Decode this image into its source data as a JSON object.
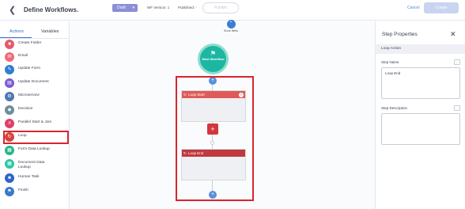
{
  "header": {
    "title": "Define Workflows.",
    "status": "Draft",
    "wf_version_label": "WF Version: 1",
    "published_label": "Published: -",
    "publish_label": "Publish",
    "cancel_label": "Cancel",
    "create_label": "Create",
    "show_fields_label": "Show fields"
  },
  "left_panel": {
    "tabs": [
      {
        "label": "Actions"
      },
      {
        "label": "Variables"
      }
    ],
    "actions": [
      {
        "label": "Create Folder",
        "color": "#e45b6a",
        "icon": "folder-icon"
      },
      {
        "label": "Email",
        "color": "#ef6b7a",
        "icon": "email-icon"
      },
      {
        "label": "Update Form",
        "color": "#2d7fcf",
        "icon": "form-icon"
      },
      {
        "label": "Update Document",
        "color": "#7d5bd0",
        "icon": "document-icon"
      },
      {
        "label": "Microservice",
        "color": "#4f78b0",
        "icon": "microservice-icon"
      },
      {
        "label": "Decision",
        "color": "#6f8e9c",
        "icon": "decision-icon"
      },
      {
        "label": "Parallel Start & Join",
        "color": "#e03f6a",
        "icon": "parallel-icon"
      },
      {
        "label": "Loop",
        "color": "#d5433f",
        "icon": "loop-icon"
      },
      {
        "label": "Form Data Lookup",
        "color": "#27b58c",
        "icon": "lookup-icon"
      },
      {
        "label": "Document Data Lookup",
        "color": "#2fc6a5",
        "icon": "document-lookup-icon"
      },
      {
        "label": "Human Task",
        "color": "#2b66c9",
        "icon": "human-task-icon"
      },
      {
        "label": "Finish",
        "color": "#3c7ac8",
        "icon": "finish-icon"
      }
    ]
  },
  "canvas": {
    "start_label": "Start Workflow",
    "loop_start_label": "Loop Start",
    "loop_end_label": "Loop End"
  },
  "right_panel": {
    "title": "Step Properties",
    "section": "Loop Action",
    "step_name_label": "Step Name",
    "step_name_value": "Loop End",
    "step_description_label": "Step Description",
    "step_description_value": ""
  },
  "colors": {
    "accent": "#3a6fd0",
    "highlight": "#d8262f",
    "start": "#1cb7a2",
    "loop_start_header": "#e05a58",
    "loop_end_header": "#c0393e"
  }
}
